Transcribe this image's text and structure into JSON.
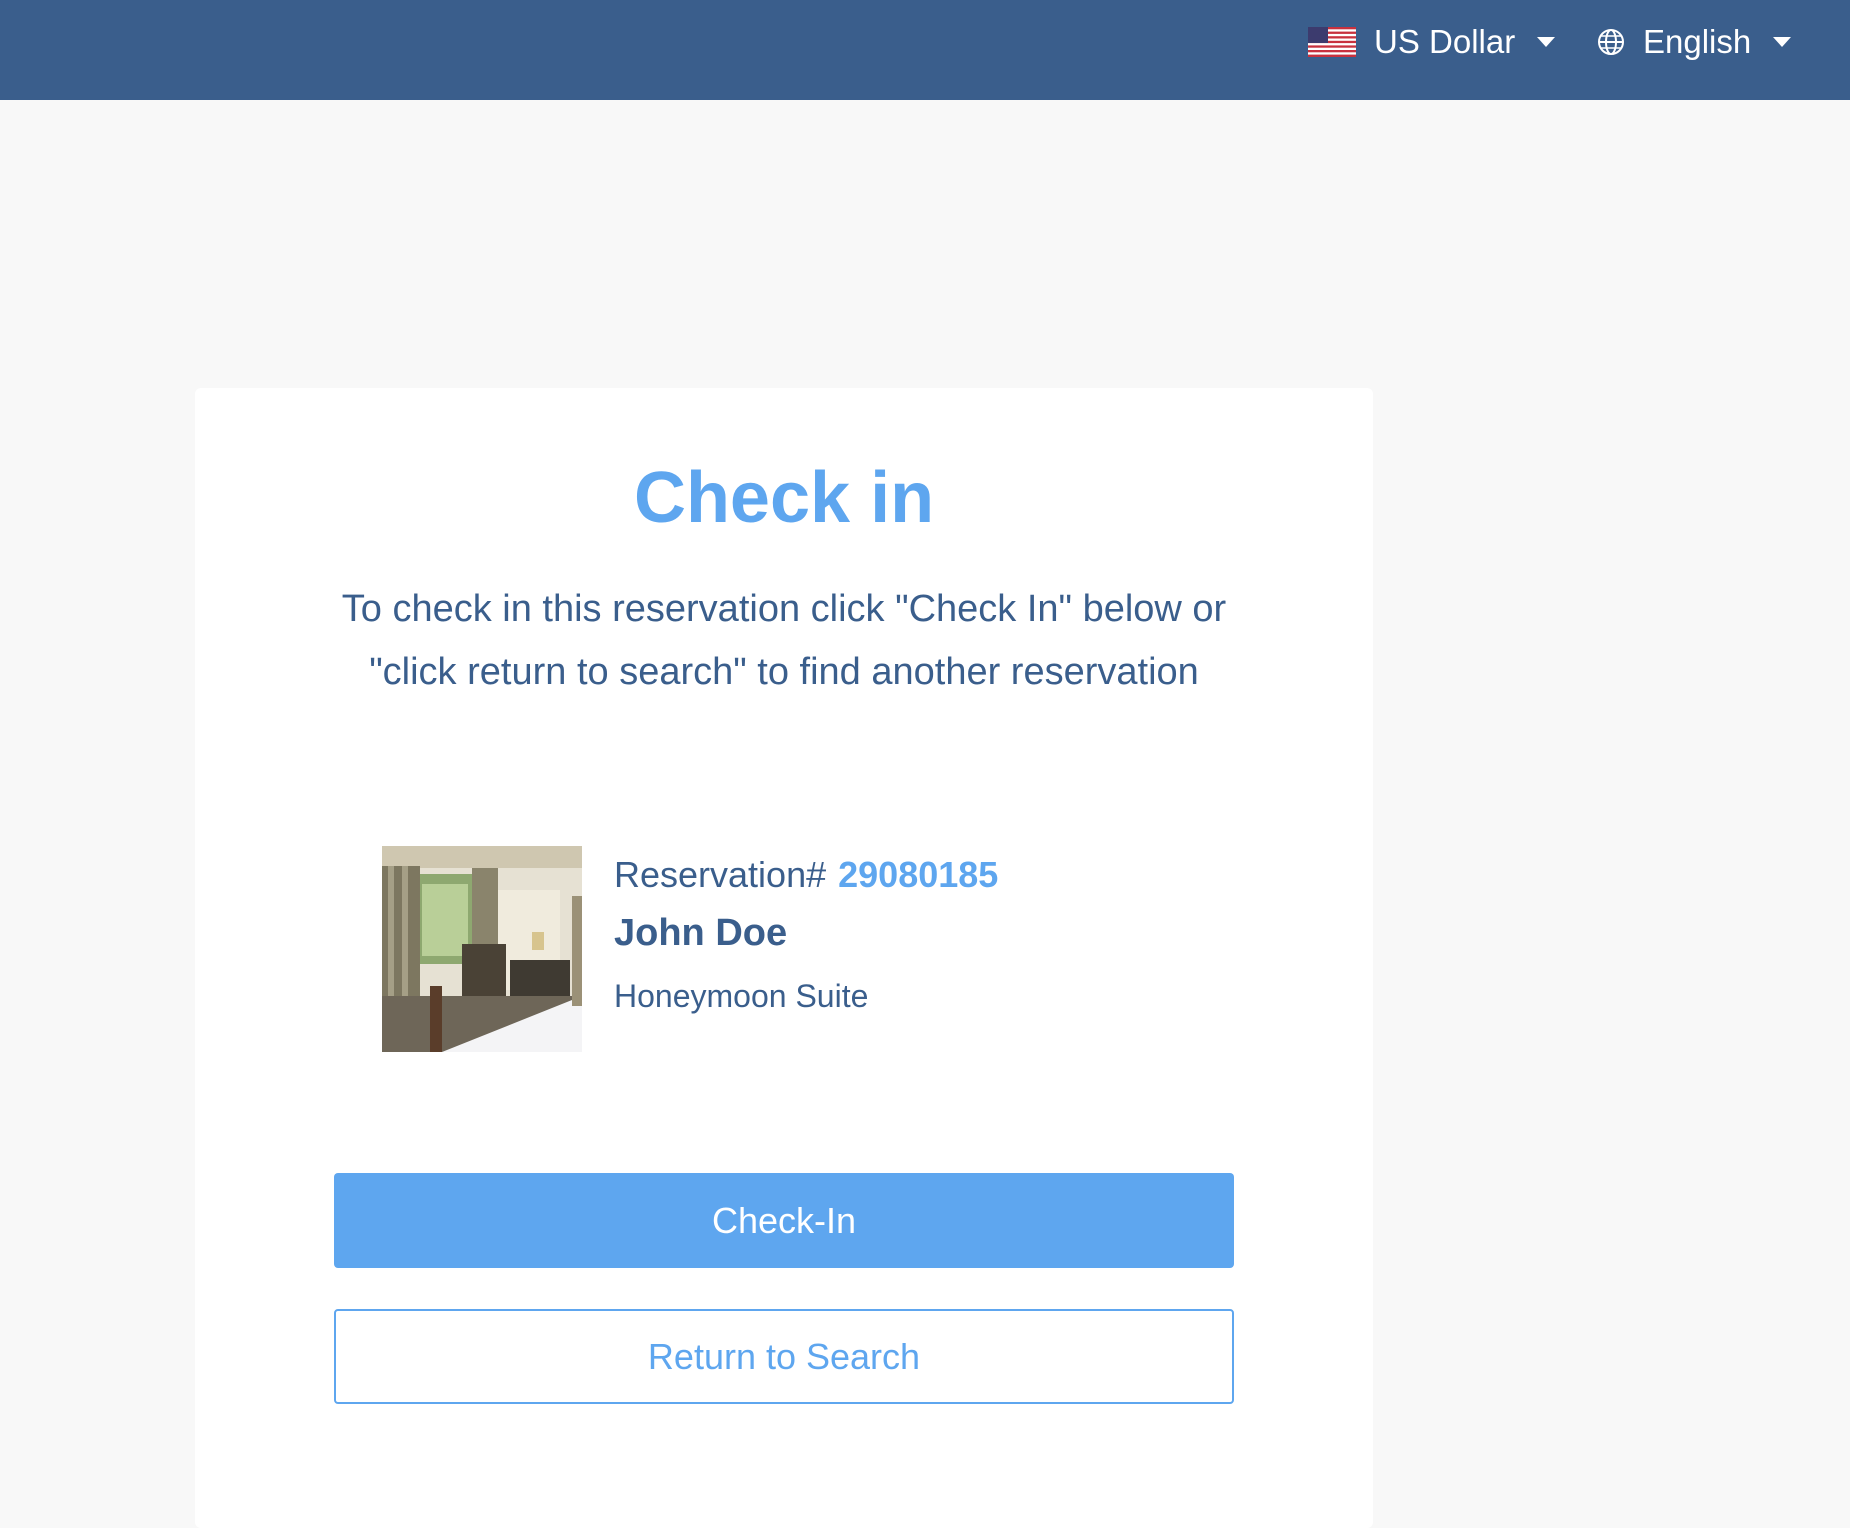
{
  "header": {
    "currency": {
      "label": "US Dollar",
      "icon": "us-flag-icon"
    },
    "language": {
      "label": "English",
      "icon": "globe-icon"
    }
  },
  "checkin": {
    "title": "Check in",
    "instructions": "To check in this reservation click \"Check In\" below or \"click return to search\" to find another reservation"
  },
  "reservation": {
    "label": "Reservation#",
    "number": "29080185",
    "guest_name": "John Doe",
    "room_type": "Honeymoon Suite"
  },
  "actions": {
    "checkin_label": "Check-In",
    "return_label": "Return to Search"
  },
  "colors": {
    "header_bg": "#3a5e8c",
    "accent": "#5ea6ef",
    "text": "#3a5e8c",
    "page_bg": "#f8f8f8"
  }
}
